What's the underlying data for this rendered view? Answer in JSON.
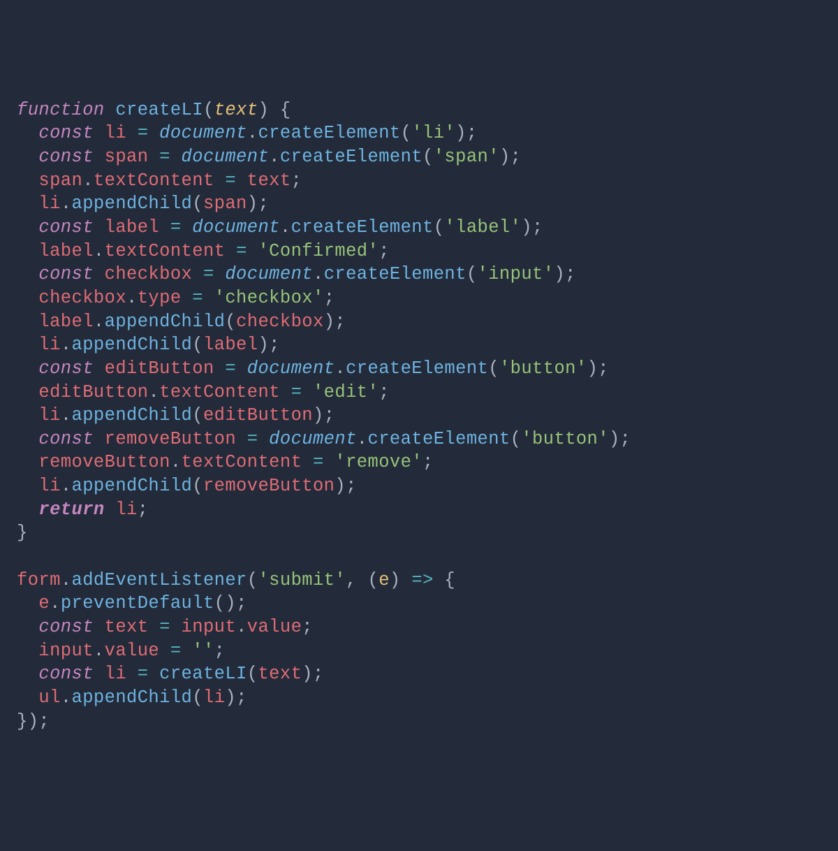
{
  "colors": {
    "background": "#232b3a",
    "default": "#abb2bf",
    "keyword": "#c586c0",
    "function": "#6eb3e0",
    "param": "#e5c07b",
    "variable": "#e06c75",
    "string": "#98c379",
    "operator": "#56b6c2",
    "indent_guide": "#3b4453"
  },
  "language": "javascript",
  "code": {
    "lines": [
      {
        "indent": 0,
        "tokens": [
          {
            "t": "function",
            "c": "kw"
          },
          {
            "t": " ",
            "c": ""
          },
          {
            "t": "createLI",
            "c": "fn"
          },
          {
            "t": "(",
            "c": "punct"
          },
          {
            "t": "text",
            "c": "param"
          },
          {
            "t": ")",
            "c": "punct"
          },
          {
            "t": " ",
            "c": ""
          },
          {
            "t": "{",
            "c": "punct"
          }
        ]
      },
      {
        "indent": 1,
        "tokens": [
          {
            "t": "const",
            "c": "kw"
          },
          {
            "t": " ",
            "c": ""
          },
          {
            "t": "li",
            "c": "var"
          },
          {
            "t": " ",
            "c": ""
          },
          {
            "t": "=",
            "c": "op"
          },
          {
            "t": " ",
            "c": ""
          },
          {
            "t": "document",
            "c": "builtin"
          },
          {
            "t": ".",
            "c": "punct"
          },
          {
            "t": "createElement",
            "c": "method"
          },
          {
            "t": "(",
            "c": "punct"
          },
          {
            "t": "'li'",
            "c": "str"
          },
          {
            "t": ")",
            "c": "punct"
          },
          {
            "t": ";",
            "c": "punct"
          }
        ]
      },
      {
        "indent": 1,
        "tokens": [
          {
            "t": "const",
            "c": "kw"
          },
          {
            "t": " ",
            "c": ""
          },
          {
            "t": "span",
            "c": "var"
          },
          {
            "t": " ",
            "c": ""
          },
          {
            "t": "=",
            "c": "op"
          },
          {
            "t": " ",
            "c": ""
          },
          {
            "t": "document",
            "c": "builtin"
          },
          {
            "t": ".",
            "c": "punct"
          },
          {
            "t": "createElement",
            "c": "method"
          },
          {
            "t": "(",
            "c": "punct"
          },
          {
            "t": "'span'",
            "c": "str"
          },
          {
            "t": ")",
            "c": "punct"
          },
          {
            "t": ";",
            "c": "punct"
          }
        ]
      },
      {
        "indent": 1,
        "tokens": [
          {
            "t": "span",
            "c": "var"
          },
          {
            "t": ".",
            "c": "punct"
          },
          {
            "t": "textContent",
            "c": "field"
          },
          {
            "t": " ",
            "c": ""
          },
          {
            "t": "=",
            "c": "op"
          },
          {
            "t": " ",
            "c": ""
          },
          {
            "t": "text",
            "c": "var"
          },
          {
            "t": ";",
            "c": "punct"
          }
        ]
      },
      {
        "indent": 1,
        "tokens": [
          {
            "t": "li",
            "c": "var"
          },
          {
            "t": ".",
            "c": "punct"
          },
          {
            "t": "appendChild",
            "c": "method"
          },
          {
            "t": "(",
            "c": "punct"
          },
          {
            "t": "span",
            "c": "var"
          },
          {
            "t": ")",
            "c": "punct"
          },
          {
            "t": ";",
            "c": "punct"
          }
        ]
      },
      {
        "indent": 1,
        "tokens": [
          {
            "t": "const",
            "c": "kw"
          },
          {
            "t": " ",
            "c": ""
          },
          {
            "t": "label",
            "c": "var"
          },
          {
            "t": " ",
            "c": ""
          },
          {
            "t": "=",
            "c": "op"
          },
          {
            "t": " ",
            "c": ""
          },
          {
            "t": "document",
            "c": "builtin"
          },
          {
            "t": ".",
            "c": "punct"
          },
          {
            "t": "createElement",
            "c": "method"
          },
          {
            "t": "(",
            "c": "punct"
          },
          {
            "t": "'label'",
            "c": "str"
          },
          {
            "t": ")",
            "c": "punct"
          },
          {
            "t": ";",
            "c": "punct"
          }
        ]
      },
      {
        "indent": 1,
        "tokens": [
          {
            "t": "label",
            "c": "var"
          },
          {
            "t": ".",
            "c": "punct"
          },
          {
            "t": "textContent",
            "c": "field"
          },
          {
            "t": " ",
            "c": ""
          },
          {
            "t": "=",
            "c": "op"
          },
          {
            "t": " ",
            "c": ""
          },
          {
            "t": "'Confirmed'",
            "c": "str"
          },
          {
            "t": ";",
            "c": "punct"
          }
        ]
      },
      {
        "indent": 1,
        "tokens": [
          {
            "t": "const",
            "c": "kw"
          },
          {
            "t": " ",
            "c": ""
          },
          {
            "t": "checkbox",
            "c": "var"
          },
          {
            "t": " ",
            "c": ""
          },
          {
            "t": "=",
            "c": "op"
          },
          {
            "t": " ",
            "c": ""
          },
          {
            "t": "document",
            "c": "builtin"
          },
          {
            "t": ".",
            "c": "punct"
          },
          {
            "t": "createElement",
            "c": "method"
          },
          {
            "t": "(",
            "c": "punct"
          },
          {
            "t": "'input'",
            "c": "str"
          },
          {
            "t": ")",
            "c": "punct"
          },
          {
            "t": ";",
            "c": "punct"
          }
        ]
      },
      {
        "indent": 1,
        "tokens": [
          {
            "t": "checkbox",
            "c": "var"
          },
          {
            "t": ".",
            "c": "punct"
          },
          {
            "t": "type",
            "c": "field"
          },
          {
            "t": " ",
            "c": ""
          },
          {
            "t": "=",
            "c": "op"
          },
          {
            "t": " ",
            "c": ""
          },
          {
            "t": "'checkbox'",
            "c": "str"
          },
          {
            "t": ";",
            "c": "punct"
          }
        ]
      },
      {
        "indent": 1,
        "tokens": [
          {
            "t": "label",
            "c": "var"
          },
          {
            "t": ".",
            "c": "punct"
          },
          {
            "t": "appendChild",
            "c": "method"
          },
          {
            "t": "(",
            "c": "punct"
          },
          {
            "t": "checkbox",
            "c": "var"
          },
          {
            "t": ")",
            "c": "punct"
          },
          {
            "t": ";",
            "c": "punct"
          }
        ]
      },
      {
        "indent": 1,
        "tokens": [
          {
            "t": "li",
            "c": "var"
          },
          {
            "t": ".",
            "c": "punct"
          },
          {
            "t": "appendChild",
            "c": "method"
          },
          {
            "t": "(",
            "c": "punct"
          },
          {
            "t": "label",
            "c": "var"
          },
          {
            "t": ")",
            "c": "punct"
          },
          {
            "t": ";",
            "c": "punct"
          }
        ]
      },
      {
        "indent": 1,
        "tokens": [
          {
            "t": "const",
            "c": "kw"
          },
          {
            "t": " ",
            "c": ""
          },
          {
            "t": "editButton",
            "c": "var"
          },
          {
            "t": " ",
            "c": ""
          },
          {
            "t": "=",
            "c": "op"
          },
          {
            "t": " ",
            "c": ""
          },
          {
            "t": "document",
            "c": "builtin"
          },
          {
            "t": ".",
            "c": "punct"
          },
          {
            "t": "createElement",
            "c": "method"
          },
          {
            "t": "(",
            "c": "punct"
          },
          {
            "t": "'button'",
            "c": "str"
          },
          {
            "t": ")",
            "c": "punct"
          },
          {
            "t": ";",
            "c": "punct"
          }
        ]
      },
      {
        "indent": 1,
        "tokens": [
          {
            "t": "editButton",
            "c": "var"
          },
          {
            "t": ".",
            "c": "punct"
          },
          {
            "t": "textContent",
            "c": "field"
          },
          {
            "t": " ",
            "c": ""
          },
          {
            "t": "=",
            "c": "op"
          },
          {
            "t": " ",
            "c": ""
          },
          {
            "t": "'edit'",
            "c": "str"
          },
          {
            "t": ";",
            "c": "punct"
          }
        ]
      },
      {
        "indent": 1,
        "tokens": [
          {
            "t": "li",
            "c": "var"
          },
          {
            "t": ".",
            "c": "punct"
          },
          {
            "t": "appendChild",
            "c": "method"
          },
          {
            "t": "(",
            "c": "punct"
          },
          {
            "t": "editButton",
            "c": "var"
          },
          {
            "t": ")",
            "c": "punct"
          },
          {
            "t": ";",
            "c": "punct"
          }
        ]
      },
      {
        "indent": 1,
        "tokens": [
          {
            "t": "const",
            "c": "kw"
          },
          {
            "t": " ",
            "c": ""
          },
          {
            "t": "removeButton",
            "c": "var"
          },
          {
            "t": " ",
            "c": ""
          },
          {
            "t": "=",
            "c": "op"
          },
          {
            "t": " ",
            "c": ""
          },
          {
            "t": "document",
            "c": "builtin"
          },
          {
            "t": ".",
            "c": "punct"
          },
          {
            "t": "createElement",
            "c": "method"
          },
          {
            "t": "(",
            "c": "punct"
          },
          {
            "t": "'button'",
            "c": "str"
          },
          {
            "t": ")",
            "c": "punct"
          },
          {
            "t": ";",
            "c": "punct"
          }
        ]
      },
      {
        "indent": 1,
        "tokens": [
          {
            "t": "removeButton",
            "c": "var"
          },
          {
            "t": ".",
            "c": "punct"
          },
          {
            "t": "textContent",
            "c": "field"
          },
          {
            "t": " ",
            "c": ""
          },
          {
            "t": "=",
            "c": "op"
          },
          {
            "t": " ",
            "c": ""
          },
          {
            "t": "'remove'",
            "c": "str"
          },
          {
            "t": ";",
            "c": "punct"
          }
        ]
      },
      {
        "indent": 1,
        "tokens": [
          {
            "t": "li",
            "c": "var"
          },
          {
            "t": ".",
            "c": "punct"
          },
          {
            "t": "appendChild",
            "c": "method"
          },
          {
            "t": "(",
            "c": "punct"
          },
          {
            "t": "removeButton",
            "c": "var"
          },
          {
            "t": ")",
            "c": "punct"
          },
          {
            "t": ";",
            "c": "punct"
          }
        ]
      },
      {
        "indent": 1,
        "tokens": [
          {
            "t": "return",
            "c": "kw-b"
          },
          {
            "t": " ",
            "c": ""
          },
          {
            "t": "li",
            "c": "var"
          },
          {
            "t": ";",
            "c": "punct"
          }
        ]
      },
      {
        "indent": 0,
        "tokens": [
          {
            "t": "}",
            "c": "punct"
          }
        ]
      },
      {
        "indent": 0,
        "tokens": []
      },
      {
        "indent": 0,
        "tokens": [
          {
            "t": "form",
            "c": "var"
          },
          {
            "t": ".",
            "c": "punct"
          },
          {
            "t": "addEventListener",
            "c": "method"
          },
          {
            "t": "(",
            "c": "punct"
          },
          {
            "t": "'submit'",
            "c": "str"
          },
          {
            "t": ",",
            "c": "punct"
          },
          {
            "t": " ",
            "c": ""
          },
          {
            "t": "(",
            "c": "punct"
          },
          {
            "t": "e",
            "c": "arrowp"
          },
          {
            "t": ")",
            "c": "punct"
          },
          {
            "t": " ",
            "c": ""
          },
          {
            "t": "=>",
            "c": "op"
          },
          {
            "t": " ",
            "c": ""
          },
          {
            "t": "{",
            "c": "punct"
          }
        ]
      },
      {
        "indent": 1,
        "tokens": [
          {
            "t": "e",
            "c": "var"
          },
          {
            "t": ".",
            "c": "punct"
          },
          {
            "t": "preventDefault",
            "c": "method"
          },
          {
            "t": "(",
            "c": "punct"
          },
          {
            "t": ")",
            "c": "punct"
          },
          {
            "t": ";",
            "c": "punct"
          }
        ]
      },
      {
        "indent": 1,
        "tokens": [
          {
            "t": "const",
            "c": "kw"
          },
          {
            "t": " ",
            "c": ""
          },
          {
            "t": "text",
            "c": "var"
          },
          {
            "t": " ",
            "c": ""
          },
          {
            "t": "=",
            "c": "op"
          },
          {
            "t": " ",
            "c": ""
          },
          {
            "t": "input",
            "c": "var"
          },
          {
            "t": ".",
            "c": "punct"
          },
          {
            "t": "value",
            "c": "field"
          },
          {
            "t": ";",
            "c": "punct"
          }
        ]
      },
      {
        "indent": 1,
        "tokens": [
          {
            "t": "input",
            "c": "var"
          },
          {
            "t": ".",
            "c": "punct"
          },
          {
            "t": "value",
            "c": "field"
          },
          {
            "t": " ",
            "c": ""
          },
          {
            "t": "=",
            "c": "op"
          },
          {
            "t": " ",
            "c": ""
          },
          {
            "t": "''",
            "c": "str"
          },
          {
            "t": ";",
            "c": "punct"
          }
        ]
      },
      {
        "indent": 1,
        "tokens": [
          {
            "t": "const",
            "c": "kw"
          },
          {
            "t": " ",
            "c": ""
          },
          {
            "t": "li",
            "c": "var"
          },
          {
            "t": " ",
            "c": ""
          },
          {
            "t": "=",
            "c": "op"
          },
          {
            "t": " ",
            "c": ""
          },
          {
            "t": "createLI",
            "c": "fn"
          },
          {
            "t": "(",
            "c": "punct"
          },
          {
            "t": "text",
            "c": "var"
          },
          {
            "t": ")",
            "c": "punct"
          },
          {
            "t": ";",
            "c": "punct"
          }
        ]
      },
      {
        "indent": 1,
        "tokens": [
          {
            "t": "ul",
            "c": "var"
          },
          {
            "t": ".",
            "c": "punct"
          },
          {
            "t": "appendChild",
            "c": "method"
          },
          {
            "t": "(",
            "c": "punct"
          },
          {
            "t": "li",
            "c": "var"
          },
          {
            "t": ")",
            "c": "punct"
          },
          {
            "t": ";",
            "c": "punct"
          }
        ]
      },
      {
        "indent": 0,
        "tokens": [
          {
            "t": "}",
            "c": "punct"
          },
          {
            "t": ")",
            "c": "punct"
          },
          {
            "t": ";",
            "c": "punct"
          }
        ]
      }
    ]
  }
}
